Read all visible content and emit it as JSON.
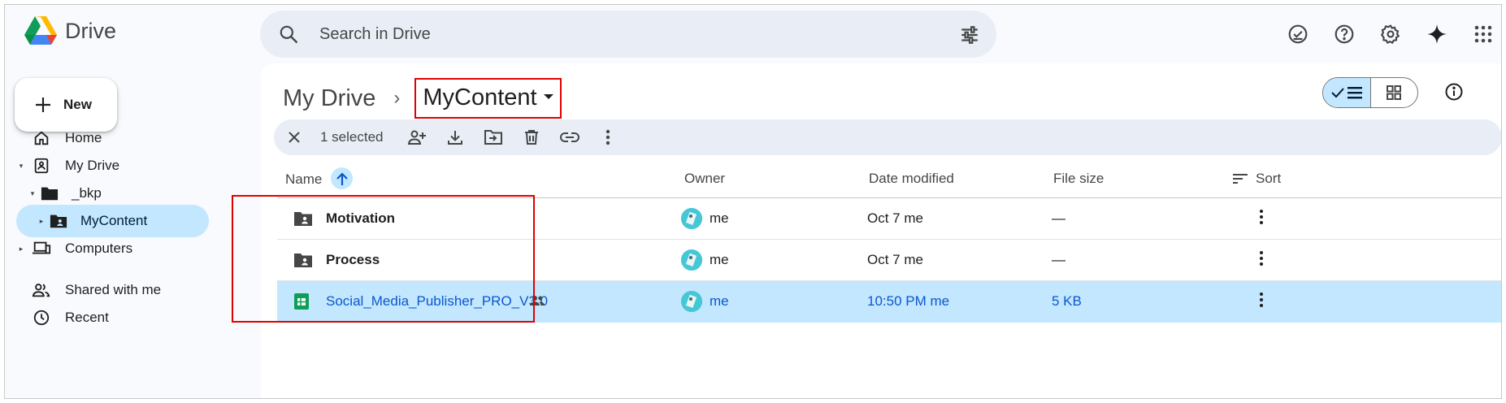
{
  "app": {
    "name": "Drive"
  },
  "search": {
    "placeholder": "Search in Drive"
  },
  "header_icons": [
    "offline-ready-icon",
    "help-icon",
    "settings-icon",
    "gemini-icon",
    "apps-grid-icon"
  ],
  "sidebar": {
    "new_label": "New",
    "items": [
      {
        "label": "Home",
        "icon": "home-icon"
      },
      {
        "label": "My Drive",
        "icon": "my-drive-icon",
        "caret": "▾"
      },
      {
        "label": "_bkp",
        "icon": "folder-icon",
        "caret": "▾"
      },
      {
        "label": "MyContent",
        "icon": "shared-folder-icon",
        "caret": "▸",
        "active": true
      },
      {
        "label": "Computers",
        "icon": "computers-icon",
        "caret": "▸"
      },
      {
        "label": "Shared with me",
        "icon": "people-icon"
      },
      {
        "label": "Recent",
        "icon": "clock-icon"
      }
    ]
  },
  "breadcrumb": {
    "root": "My Drive",
    "separator": "›",
    "current": "MyContent"
  },
  "selection_bar": {
    "text": "1 selected"
  },
  "table": {
    "headers": {
      "name": "Name",
      "owner": "Owner",
      "modified": "Date modified",
      "size": "File size",
      "sort": "Sort"
    },
    "rows": [
      {
        "name": "Motivation",
        "owner": "me",
        "modified": "Oct 7 me",
        "size": "—",
        "type": "shared-folder"
      },
      {
        "name": "Process",
        "owner": "me",
        "modified": "Oct 7 me",
        "size": "—",
        "type": "shared-folder"
      },
      {
        "name": "Social_Media_Publisher_PRO_V3.0",
        "owner": "me",
        "modified": "10:50 PM me",
        "size": "5 KB",
        "type": "sheets",
        "shared": true,
        "selected": true
      }
    ]
  },
  "colors": {
    "accent": "#0b57d0",
    "selected": "#c2e7ff",
    "annotation": "#e00000"
  }
}
